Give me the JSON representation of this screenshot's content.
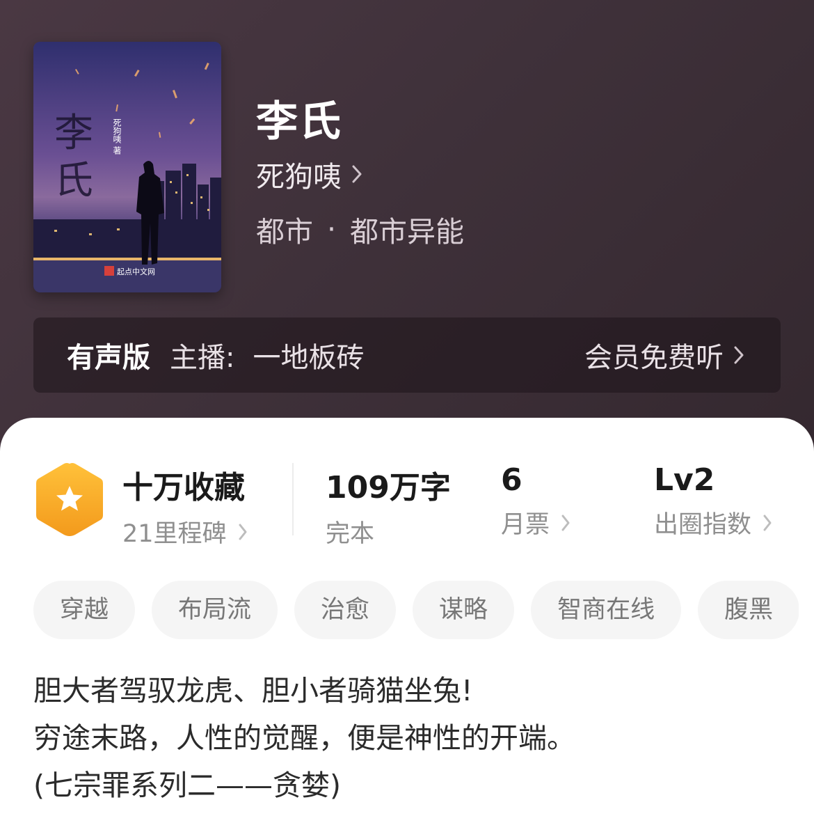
{
  "book": {
    "title": "李氏",
    "author": "死狗咦",
    "genre": "都市",
    "subgenre": "都市异能",
    "genre_separator": "·",
    "cover": {
      "title_text": "李氏",
      "author_text": "死狗咦",
      "publisher_text": "起点中文网"
    }
  },
  "audio": {
    "badge": "有声版",
    "host_label": "主播:",
    "host_name": "一地板砖",
    "action": "会员免费听"
  },
  "stats": {
    "collect": {
      "main": "十万收藏",
      "sub": "21里程碑"
    },
    "words": {
      "main": "109万字",
      "sub": "完本"
    },
    "tickets": {
      "main": "6",
      "sub": "月票"
    },
    "index": {
      "main": "Lv2",
      "sub": "出圈指数"
    }
  },
  "tags": [
    "穿越",
    "布局流",
    "治愈",
    "谋略",
    "智商在线",
    "腹黑"
  ],
  "description": [
    "胆大者驾驭龙虎、胆小者骑猫坐兔!",
    "穷途末路，人性的觉醒，便是神性的开端。",
    "(七宗罪系列二——贪婪)"
  ],
  "colors": {
    "header_bg": "#3e2f38",
    "badge_orange": "#f6a623",
    "panel_bg": "#ffffff",
    "tag_bg": "#f5f5f5"
  }
}
